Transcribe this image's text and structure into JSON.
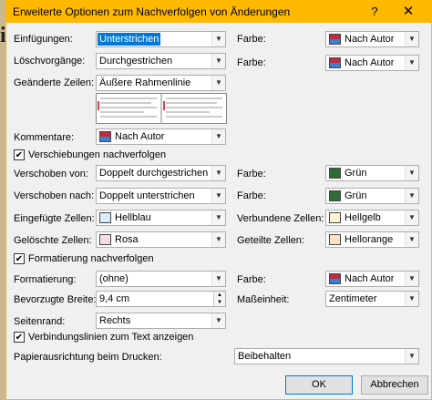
{
  "window": {
    "title": "Erweiterte Optionen zum Nachverfolgen von Änderungen",
    "help_glyph": "?",
    "close_glyph": "✕"
  },
  "background": {
    "glyph": "i"
  },
  "insertions": {
    "label": "Einfügungen:",
    "value": "Unterstrichen",
    "color_label": "Farbe:",
    "color_value": "Nach Autor"
  },
  "deletions": {
    "label": "Löschvorgänge:",
    "value": "Durchgestrichen",
    "color_label": "Farbe:",
    "color_value": "Nach Autor"
  },
  "changed_lines": {
    "label": "Geänderte Zeilen:",
    "value": "Äußere Rahmenlinie"
  },
  "comments": {
    "label": "Kommentare:",
    "value": "Nach Autor"
  },
  "moves": {
    "checkbox_label": "Verschiebungen nachverfolgen",
    "checked": true,
    "from_label": "Verschoben von:",
    "from_value": "Doppelt durchgestrichen",
    "from_color_label": "Farbe:",
    "from_color_value": "Grün",
    "to_label": "Verschoben nach:",
    "to_value": "Doppelt unterstrichen",
    "to_color_label": "Farbe:",
    "to_color_value": "Grün"
  },
  "table_cells": {
    "inserted_label": "Eingefügte Zellen:",
    "inserted_value": "Hellblau",
    "merged_label": "Verbundene Zellen:",
    "merged_value": "Hellgelb",
    "deleted_label": "Gelöschte Zellen:",
    "deleted_value": "Rosa",
    "split_label": "Geteilte Zellen:",
    "split_value": "Hellorange"
  },
  "formatting": {
    "checkbox_label": "Formatierung nachverfolgen",
    "checked": true,
    "label": "Formatierung:",
    "value": "(ohne)",
    "color_label": "Farbe:",
    "color_value": "Nach Autor"
  },
  "balloons": {
    "width_label": "Bevorzugte Breite:",
    "width_value": "9,4 cm",
    "unit_label": "Maßeinheit:",
    "unit_value": "Zentimeter",
    "margin_label": "Seitenrand:",
    "margin_value": "Rechts",
    "lines_checkbox_label": "Verbindungslinien zum Text anzeigen",
    "lines_checked": true,
    "orientation_label": "Papierausrichtung beim Drucken:",
    "orientation_value": "Beibehalten"
  },
  "buttons": {
    "ok": "OK",
    "cancel": "Abbrechen"
  },
  "colors": {
    "title_bar": "#ffb900",
    "selection": "#0078d7",
    "gruen": "#2e6b35",
    "hellblau": "#d9ecf8",
    "hellgelb": "#fff4cf",
    "rosa": "#f8dde4",
    "hellorange": "#fbe2c9",
    "author_top": "#c22a3e",
    "author_bottom": "#3a7fd0"
  },
  "icons": [
    "help-icon",
    "close-icon",
    "dropdown-arrow-icon",
    "checkmark-icon",
    "color-swatch-icon",
    "spin-up-icon",
    "spin-down-icon"
  ]
}
